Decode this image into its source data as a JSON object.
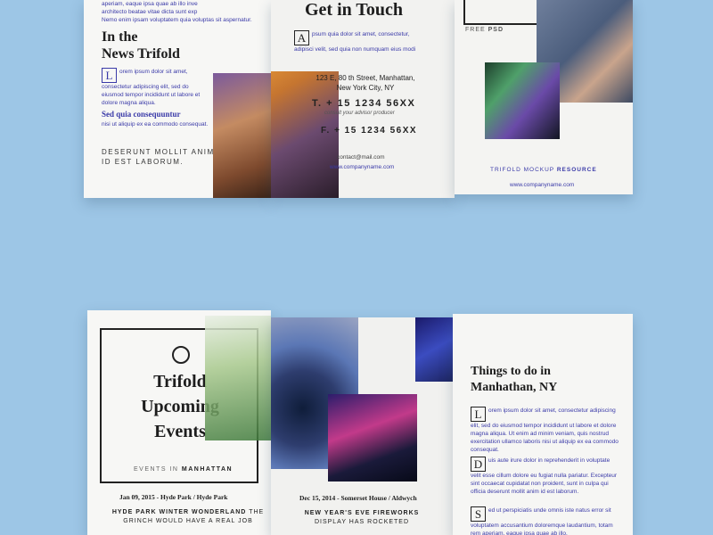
{
  "top": {
    "left_panel": {
      "intro_line1": "aperiam, eaque ipsa quae ab illo inve",
      "intro_line2": "architecto beatae vitae dicta sunt exp",
      "intro_line3": "Nemo enim ipsam voluptatem quia voluptas sit aspernatur.",
      "title_line1": "In the",
      "title_line2": "News Trifold",
      "dropcap": "L",
      "para1": "orem ipsum dolor sit amet, consectetur adipiscing elit, sed do eiusmod tempor incididunt ut labore et dolore magna aliqua.",
      "subhead": "Sed quia consequuntur",
      "para2": "nisi ut aliquip ex ea commodo consequat.",
      "footer_line1": "DESERUNT MOLLIT ANIM",
      "footer_line2": "ID EST LABORUM."
    },
    "middle_panel": {
      "title": "Get in Touch",
      "dropcap": "A",
      "para": "psum quia dolor sit amet, consectetur, adipisci velit, sed quia non numquam eius modi",
      "address_line1": "123 E, 80 th Street, Manhattan,",
      "address_line2": "New York City, NY",
      "phone1": "T. + 15 1234 56XX",
      "phone_note": "consult your advisor producer",
      "phone2": "F. + 15 1234 56XX",
      "email": "contact@mail.com",
      "website": "www.companyname.com"
    },
    "right_panel": {
      "free_label": "FREE",
      "psd_label": "PSD",
      "resource_line_a": "TRIFOLD MOCKUP",
      "resource_line_b": "RESOURCE",
      "website": "www.companyname.com"
    }
  },
  "bottom": {
    "left_panel": {
      "title_line1": "Trifold",
      "title_line2": "Upcoming",
      "title_line3": "Events",
      "events_in": "EVENTS IN",
      "events_city": "MANHATTAN",
      "event_date": "Jan 09, 2015 - Hyde Park / Hyde Park",
      "event_title_a": "HYDE PARK WINTER WONDERLAND",
      "event_title_b": "THE",
      "event_title_line2": "GRINCH WOULD HAVE A REAL JOB"
    },
    "middle_panel": {
      "event_date": "Dec 15, 2014 - Somerset House / Aldwych",
      "event_title_line1": "NEW YEAR'S EVE FIREWORKS",
      "event_title_line2": "DISPLAY HAS ROCKETED"
    },
    "right_panel": {
      "title_line1": "Things to do in",
      "title_line2": "Manhathan, NY",
      "items": [
        {
          "dropcap": "L",
          "text": "orem ipsum dolor sit amet, consectetur adipiscing elit, sed do eiusmod tempor incididunt ut labore et dolore magna aliqua. Ut enim ad minim veniam, quis nostrud exercitation ullamco laboris nisi ut aliquip ex ea commodo consequat."
        },
        {
          "dropcap": "D",
          "text": "uis aute irure dolor in reprehenderit in voluptate velit esse cillum dolore eu fugiat nulla pariatur. Excepteur sint occaecat cupidatat non proident, sunt in culpa qui officia deserunt mollit anim id est laborum."
        },
        {
          "dropcap": "S",
          "text": "ed ut perspiciatis unde omnis iste natus error sit voluptatem accusantium doloremque laudantium, totam rem aperiam, eaque ipsa quae ab illo."
        }
      ]
    }
  }
}
